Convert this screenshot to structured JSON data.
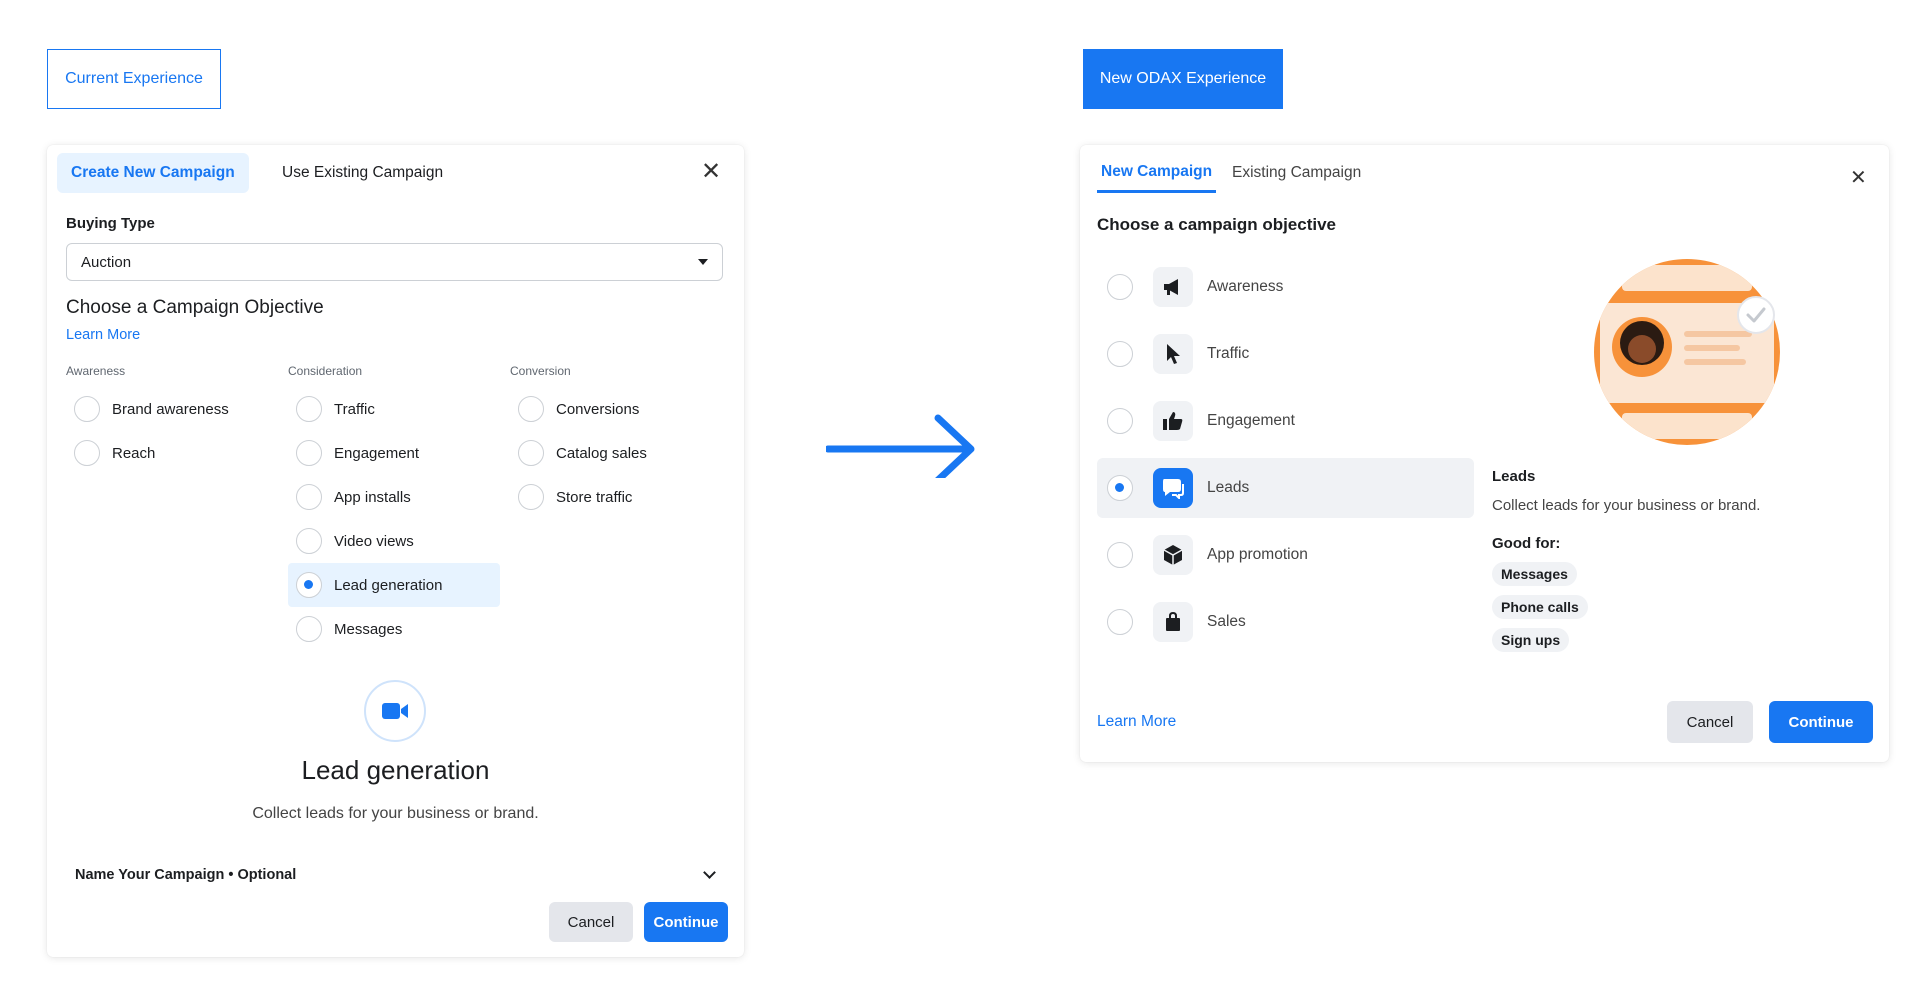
{
  "labels": {
    "current": "Current Experience",
    "odax": "New ODAX Experience"
  },
  "old": {
    "tabs": [
      "Create New Campaign",
      "Use Existing Campaign"
    ],
    "buying_type_label": "Buying Type",
    "buying_type_value": "Auction",
    "objective_heading": "Choose a Campaign Objective",
    "learn_more": "Learn More",
    "columns": [
      {
        "header": "Awareness",
        "items": [
          "Brand awareness",
          "Reach"
        ]
      },
      {
        "header": "Consideration",
        "items": [
          "Traffic",
          "Engagement",
          "App installs",
          "Video views",
          "Lead generation",
          "Messages"
        ]
      },
      {
        "header": "Conversion",
        "items": [
          "Conversions",
          "Catalog sales",
          "Store traffic"
        ]
      }
    ],
    "selected": "Lead generation",
    "selected_title": "Lead generation",
    "selected_desc": "Collect leads for your business or brand.",
    "name_campaign": "Name Your Campaign • Optional",
    "cancel": "Cancel",
    "continue": "Continue"
  },
  "new": {
    "tabs": [
      "New Campaign",
      "Existing Campaign"
    ],
    "heading": "Choose a campaign objective",
    "objectives": [
      {
        "label": "Awareness",
        "icon": "megaphone-icon"
      },
      {
        "label": "Traffic",
        "icon": "cursor-icon"
      },
      {
        "label": "Engagement",
        "icon": "thumbs-up-icon"
      },
      {
        "label": "Leads",
        "icon": "chat-bubble-icon"
      },
      {
        "label": "App promotion",
        "icon": "cube-icon"
      },
      {
        "label": "Sales",
        "icon": "shopping-bag-icon"
      }
    ],
    "selected": "Leads",
    "detail_title": "Leads",
    "detail_desc": "Collect leads for your business or brand.",
    "good_for_label": "Good for:",
    "good_for": [
      "Messages",
      "Phone calls",
      "Sign ups"
    ],
    "learn_more": "Learn More",
    "cancel": "Cancel",
    "continue": "Continue"
  },
  "colors": {
    "accent": "#1877f2",
    "illustration_orange": "#f7923a"
  }
}
